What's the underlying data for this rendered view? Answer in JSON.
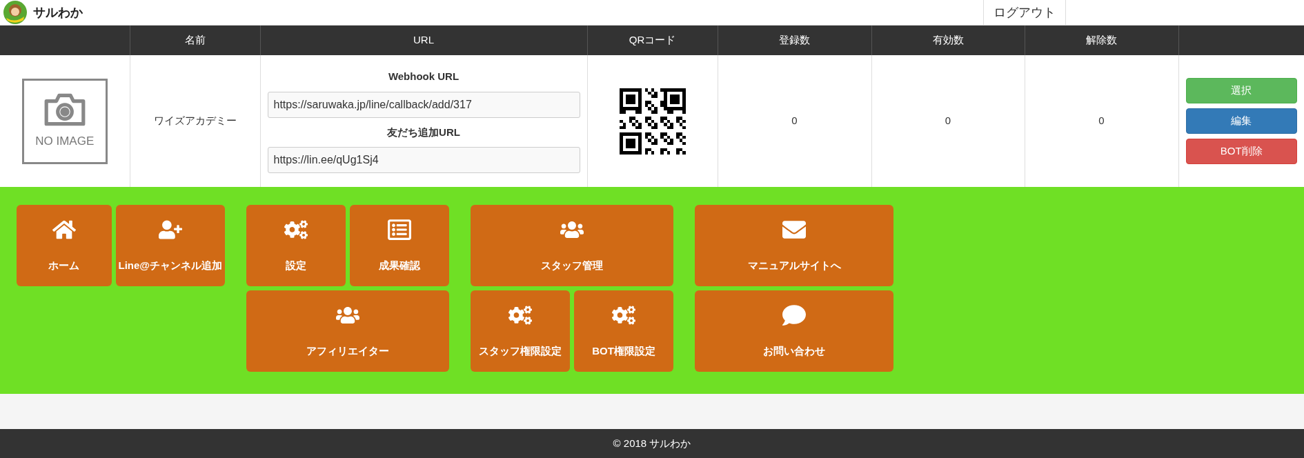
{
  "header": {
    "logo_text": "サルわか",
    "logout": "ログアウト"
  },
  "table": {
    "columns": [
      "名前",
      "URL",
      "QRコード",
      "登録数",
      "有効数",
      "解除数"
    ],
    "rows": [
      {
        "image_text": "NO IMAGE",
        "name": "ワイズアカデミー",
        "webhook_label": "Webhook URL",
        "webhook_url": "https://saruwaka.jp/line/callback/add/317",
        "friend_label": "友だち追加URL",
        "friend_url": "https://lin.ee/qUg1Sj4",
        "registered": "0",
        "active": "0",
        "cancelled": "0",
        "buttons": [
          {
            "label": "選択",
            "kind": "success"
          },
          {
            "label": "編集",
            "kind": "primary"
          },
          {
            "label": "BOT削除",
            "kind": "danger"
          }
        ]
      }
    ]
  },
  "menu": [
    {
      "rows": [
        [
          {
            "label": "ホーム",
            "kind": "home"
          },
          {
            "label": "Line@チャンネル追加",
            "kind": "add"
          }
        ]
      ]
    },
    {
      "rows": [
        [
          {
            "label": "設定",
            "kind": "settings"
          },
          {
            "label": "成果確認",
            "kind": "report"
          }
        ],
        [
          {
            "label": "アフィリエイター",
            "kind": "people"
          }
        ]
      ]
    },
    {
      "rows": [
        [
          {
            "label": "スタッフ管理",
            "kind": "people"
          }
        ],
        [
          {
            "label": "スタッフ権限設定",
            "kind": "settings"
          },
          {
            "label": "BOT権限設定",
            "kind": "settings"
          }
        ]
      ]
    },
    {
      "rows": [
        [
          {
            "label": "マニュアルサイトへ",
            "kind": "mail"
          }
        ],
        [
          {
            "label": "お問い合わせ",
            "kind": "chat"
          }
        ]
      ]
    }
  ],
  "footer": "© 2018 サルわか"
}
